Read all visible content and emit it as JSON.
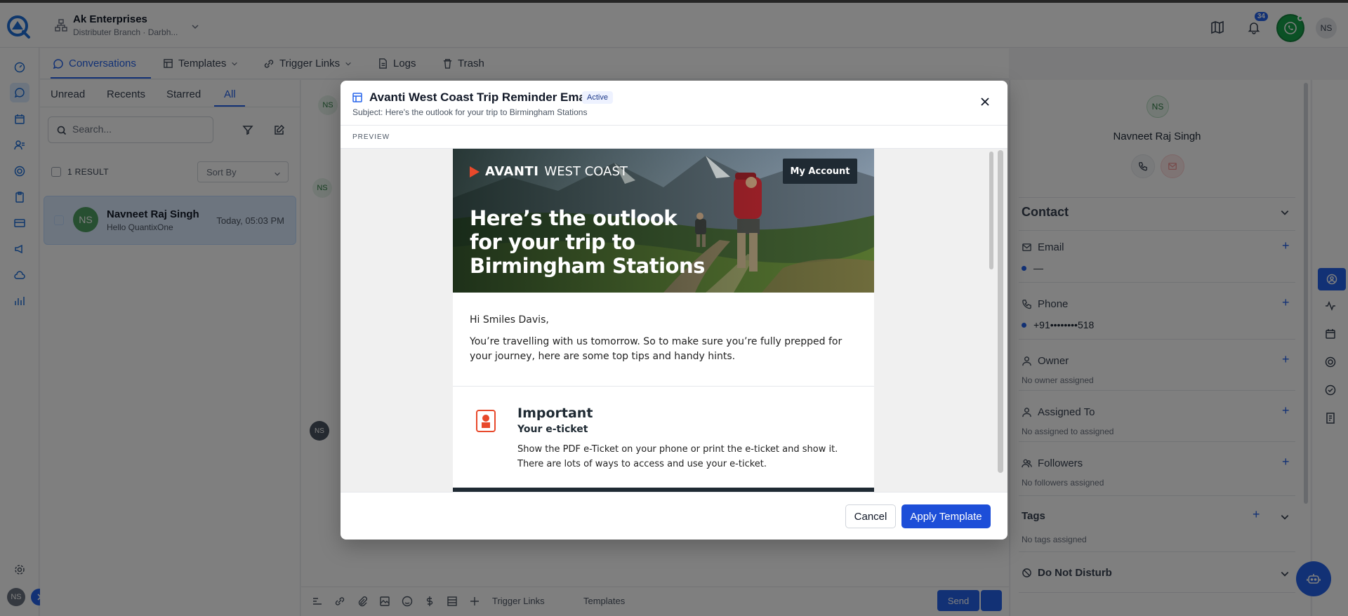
{
  "header": {
    "org_name": "Ak Enterprises",
    "org_sub": "Distributer Branch · Darbh...",
    "notification_count": "34",
    "user_initials": "NS"
  },
  "subtabs": [
    {
      "label": "Conversations"
    },
    {
      "label": "Templates"
    },
    {
      "label": "Trigger Links"
    },
    {
      "label": "Logs"
    },
    {
      "label": "Trash"
    }
  ],
  "convlist": {
    "filters": [
      "Unread",
      "Recents",
      "Starred",
      "All"
    ],
    "search_placeholder": "Search...",
    "result_count": "1 RESULT",
    "sort_label": "Sort By",
    "items": [
      {
        "initials": "NS",
        "name": "Navneet Raj Singh",
        "message": "Hello QuantixOne",
        "time": "Today, 05:03 PM"
      }
    ]
  },
  "chat": {
    "avatar_initials": "NS",
    "toolbar": {
      "trigger_links": "Trigger Links",
      "templates": "Templates",
      "send": "Send"
    }
  },
  "contact": {
    "initials": "NS",
    "name": "Navneet Raj Singh",
    "section_title": "Contact",
    "email_label": "Email",
    "email_value": "—",
    "phone_label": "Phone",
    "phone_value": "+91••••••••518",
    "owner_label": "Owner",
    "owner_value": "No owner assigned",
    "assigned_label": "Assigned To",
    "assigned_value": "No assigned to assigned",
    "followers_label": "Followers",
    "followers_value": "No followers assigned",
    "tags_label": "Tags",
    "tags_value": "No tags assigned",
    "dnd_label": "Do Not Disturb"
  },
  "modal": {
    "title": "Avanti West Coast Trip Reminder Email",
    "badge": "Active",
    "subject": "Subject: Here's the outlook for your trip to Birmingham Stations",
    "preview_label": "PREVIEW",
    "cancel_label": "Cancel",
    "apply_label": "Apply Template",
    "email": {
      "brand_bold": "AVANTI",
      "brand_light": "WEST COAST",
      "account_button": "My Account",
      "headline": "Here’s the outlook for your trip to Birmingham Stations",
      "greeting": "Hi Smiles Davis,",
      "intro": "You’re travelling with us tomorrow. So to make sure you’re fully prepped for your journey, here are some top tips and handy hints.",
      "important_title": "Important",
      "important_sub": "Your e-ticket",
      "important_body": "Show the PDF e-Ticket on your phone or print the e-ticket and show it. There are lots of ways to access and use your e-ticket."
    }
  },
  "colors": {
    "accent": "#2563eb",
    "brand_dark": "#1f2a33",
    "avanti_orange": "#e8492b"
  }
}
